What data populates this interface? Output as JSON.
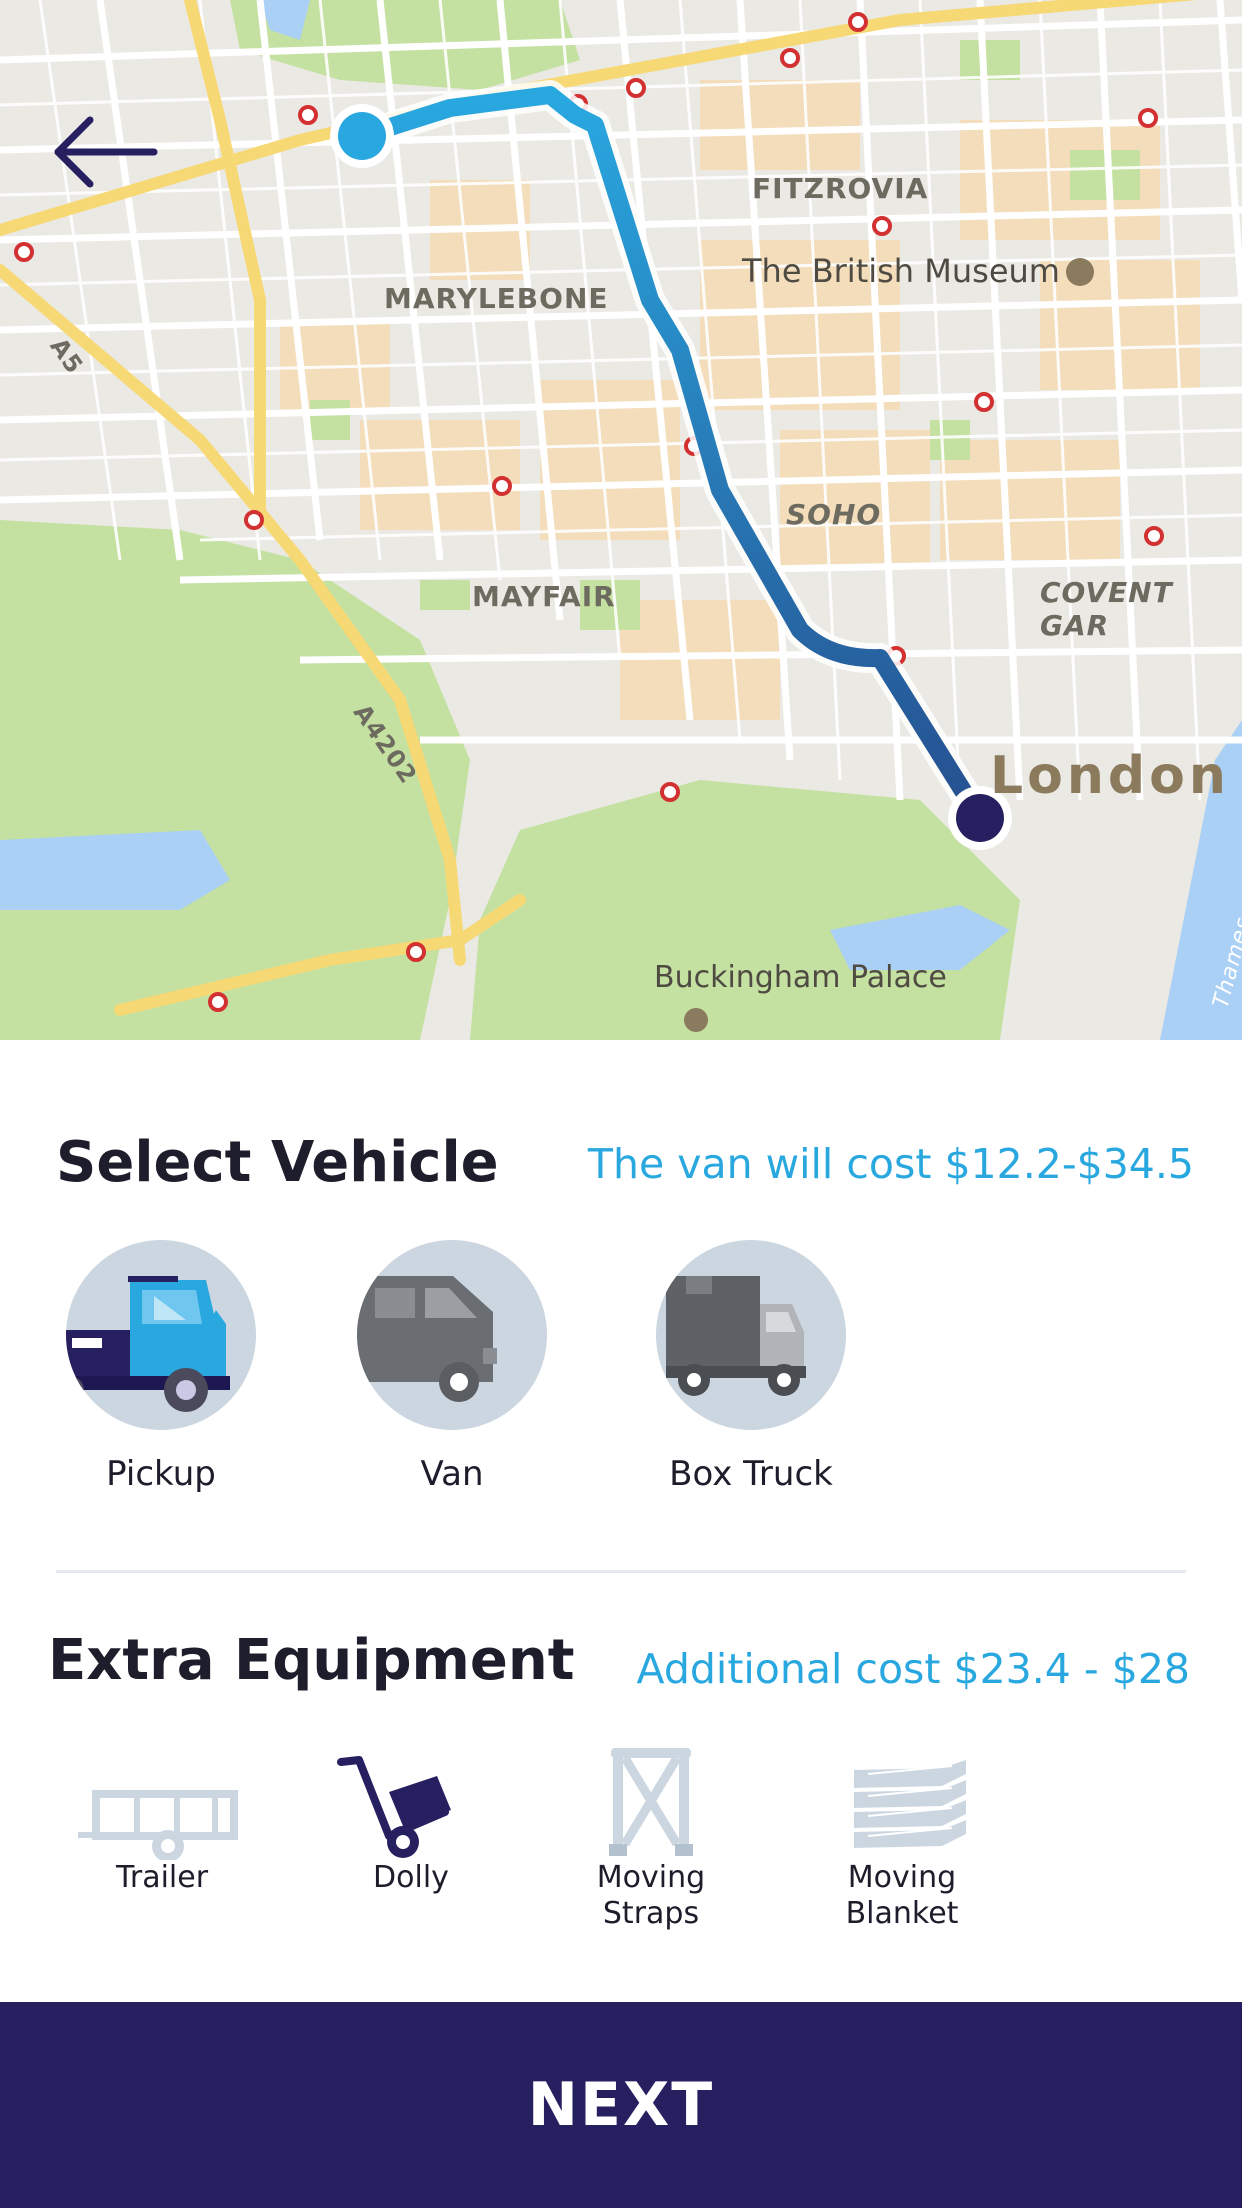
{
  "map": {
    "labels": {
      "fitzrovia": "FITZROVIA",
      "british_museum": "The British Museum",
      "marylebone": "MARYLEBONE",
      "a5": "A5",
      "soho": "SOHO",
      "mayfair": "MAYFAIR",
      "covent_garden": "COVENT GAR",
      "a4202": "A4202",
      "london": "London",
      "buckingham": "Buckingham Palace",
      "thames": "Thames"
    },
    "route_colors": {
      "start": "#29a8e0",
      "end": "#264f8f"
    },
    "origin_color": "#29a8e0",
    "destination_color": "#261f60"
  },
  "back_icon": "arrow-left-icon",
  "vehicle_section": {
    "title": "Select Vehicle",
    "cost": "The van will cost $12.2-$34.5",
    "vehicles": [
      {
        "label": "Pickup",
        "icon": "pickup-truck-icon",
        "selected": true
      },
      {
        "label": "Van",
        "icon": "van-icon",
        "selected": false
      },
      {
        "label": "Box Truck",
        "icon": "box-truck-icon",
        "selected": false
      }
    ]
  },
  "equipment_section": {
    "title": "Extra Equipment",
    "cost": "Additional cost $23.4 - $28",
    "items": [
      {
        "label": "Trailer",
        "icon": "trailer-icon",
        "selected": false
      },
      {
        "label": "Dolly",
        "icon": "dolly-icon",
        "selected": true
      },
      {
        "label": "Moving Straps",
        "line1": "Moving",
        "line2": "Straps",
        "icon": "straps-icon",
        "selected": false
      },
      {
        "label": "Moving Blanket",
        "line1": "Moving",
        "line2": "Blanket",
        "icon": "blanket-icon",
        "selected": false
      }
    ]
  },
  "next_button": {
    "label": "NEXT"
  },
  "colors": {
    "accent": "#29a8e0",
    "primary": "#261f60",
    "inactive": "#ccd6e0"
  }
}
